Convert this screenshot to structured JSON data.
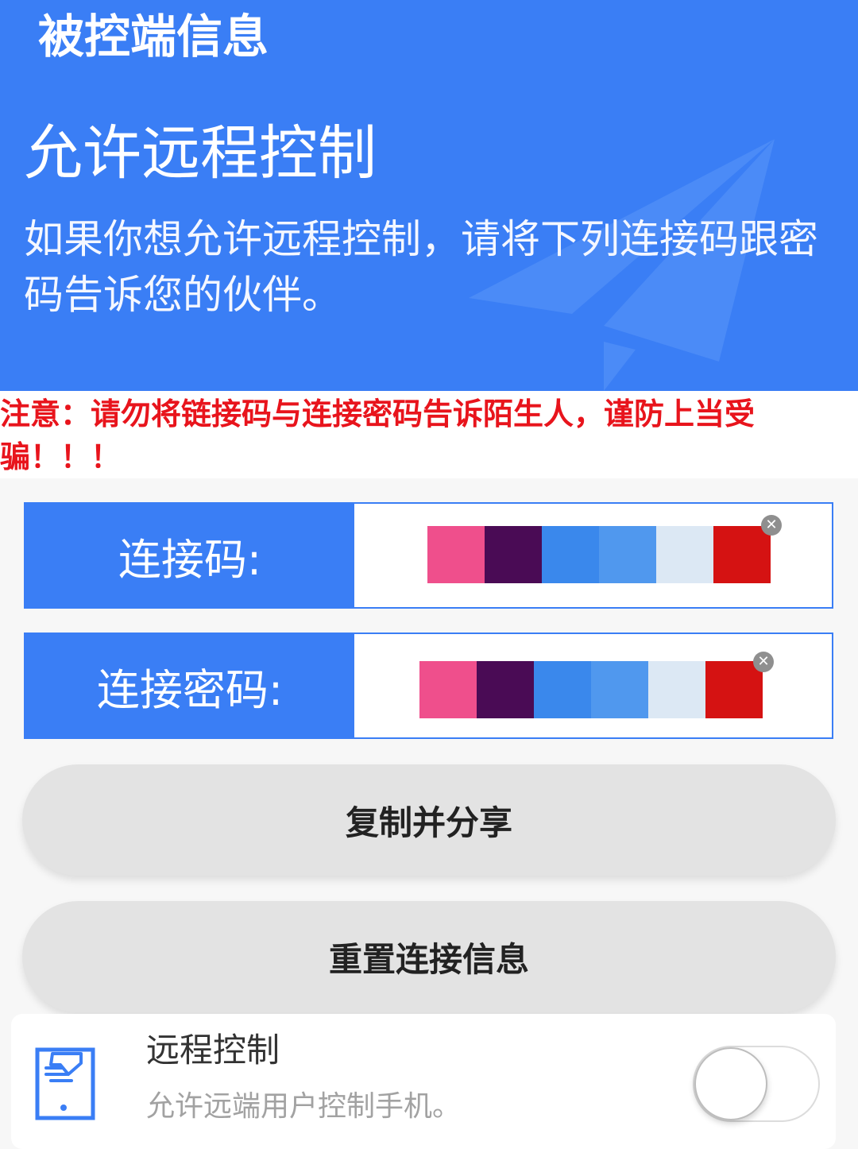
{
  "header": {
    "app_title": "被控端信息",
    "hero_title": "允许远程控制",
    "hero_desc": "如果你想允许远程控制，请将下列连接码跟密码告诉您的伙伴。"
  },
  "warning": {
    "text": "注意：请勿将链接码与连接密码告诉陌生人，谨防上当受骗！！！"
  },
  "connection": {
    "code_label": "连接码:",
    "password_label": "连接密码:",
    "redaction_colors": [
      "#ef4f8c",
      "#4a0b55",
      "#3a88ec",
      "#5098ee",
      "#dce8f4",
      "#d51212"
    ]
  },
  "buttons": {
    "copy_share": "复制并分享",
    "reset_info": "重置连接信息"
  },
  "remote_control": {
    "title": "远程控制",
    "subtitle": "允许远端用户控制手机。",
    "enabled": false
  },
  "colors": {
    "primary": "#3a7ef5",
    "warning": "#e8141c"
  }
}
